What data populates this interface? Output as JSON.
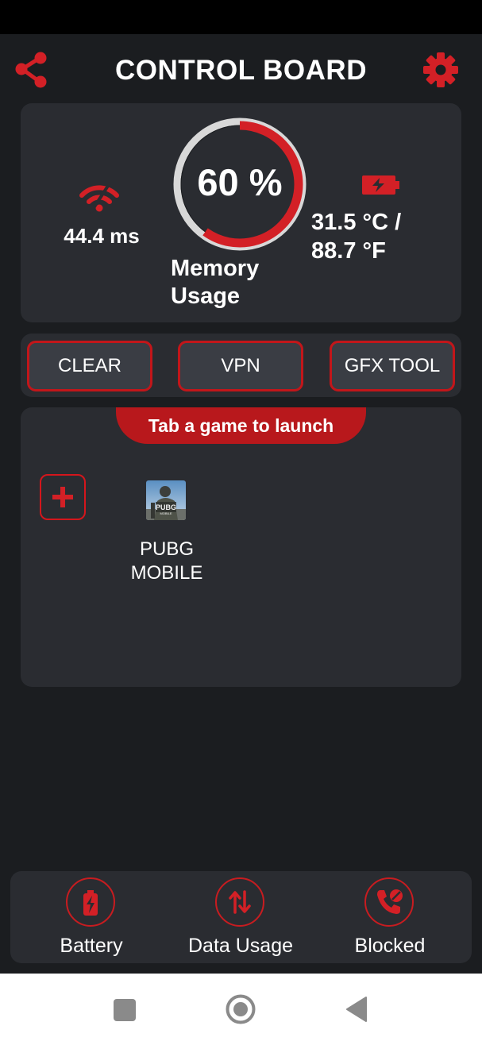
{
  "header": {
    "title": "CONTROL BOARD"
  },
  "stats": {
    "ping_value": "44.4 ms",
    "memory_percent_label": "60 %",
    "memory_fraction": 0.6,
    "memory_label": "Memory Usage",
    "temp_celsius": "31.5 °C /",
    "temp_fahrenheit": "88.7 °F"
  },
  "actions": {
    "clear_label": "CLEAR",
    "vpn_label": "VPN",
    "gfx_label": "GFX TOOL"
  },
  "games": {
    "banner": "Tab a game to launch",
    "items": [
      {
        "name_line1": "PUBG",
        "name_line2": "MOBILE",
        "thumb_text": "PUBG",
        "thumb_subtext": "MOBILE"
      }
    ]
  },
  "bottom_nav": {
    "battery_label": "Battery",
    "data_label": "Data Usage",
    "blocked_label": "Blocked"
  },
  "icons": {
    "share": "share-icon",
    "settings": "gear-icon",
    "ping": "wifi-off-icon",
    "battery": "battery-charging-icon",
    "add": "plus-icon",
    "nav_battery": "battery-charging-icon",
    "nav_data": "data-transfer-icon",
    "nav_blocked": "blocked-call-icon"
  },
  "colors": {
    "accent": "#d32026",
    "background": "#1b1d20",
    "card": "#2a2c31",
    "button": "#3a3d44"
  }
}
